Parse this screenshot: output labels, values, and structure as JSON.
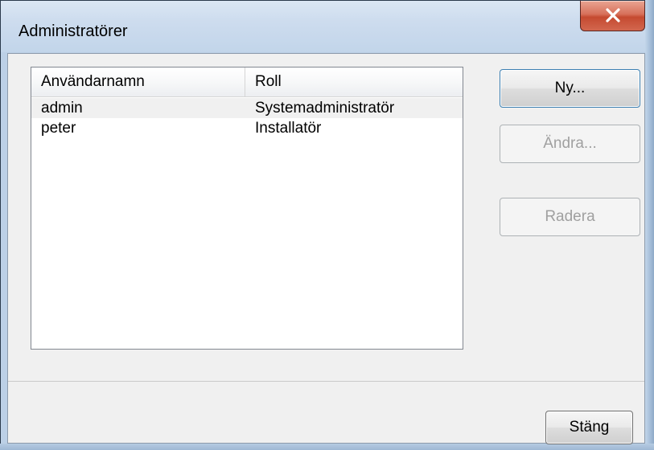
{
  "window": {
    "title": "Administratörer",
    "close_label": "X"
  },
  "table": {
    "columns": [
      "Användarnamn",
      "Roll"
    ],
    "rows": [
      {
        "user": "admin",
        "role": "Systemadministratör",
        "selected": true
      },
      {
        "user": "peter",
        "role": "Installatör",
        "selected": false
      }
    ]
  },
  "buttons": {
    "new_label": "Ny...",
    "edit_label": "Ändra...",
    "delete_label": "Radera",
    "close_label": "Stäng"
  },
  "icons": {
    "close": "close-icon"
  },
  "colors": {
    "titlebar": "#c9dbee",
    "close_button": "#c75c44",
    "client_background": "#f0f0f0",
    "disabled_text": "#a0a0a0"
  }
}
